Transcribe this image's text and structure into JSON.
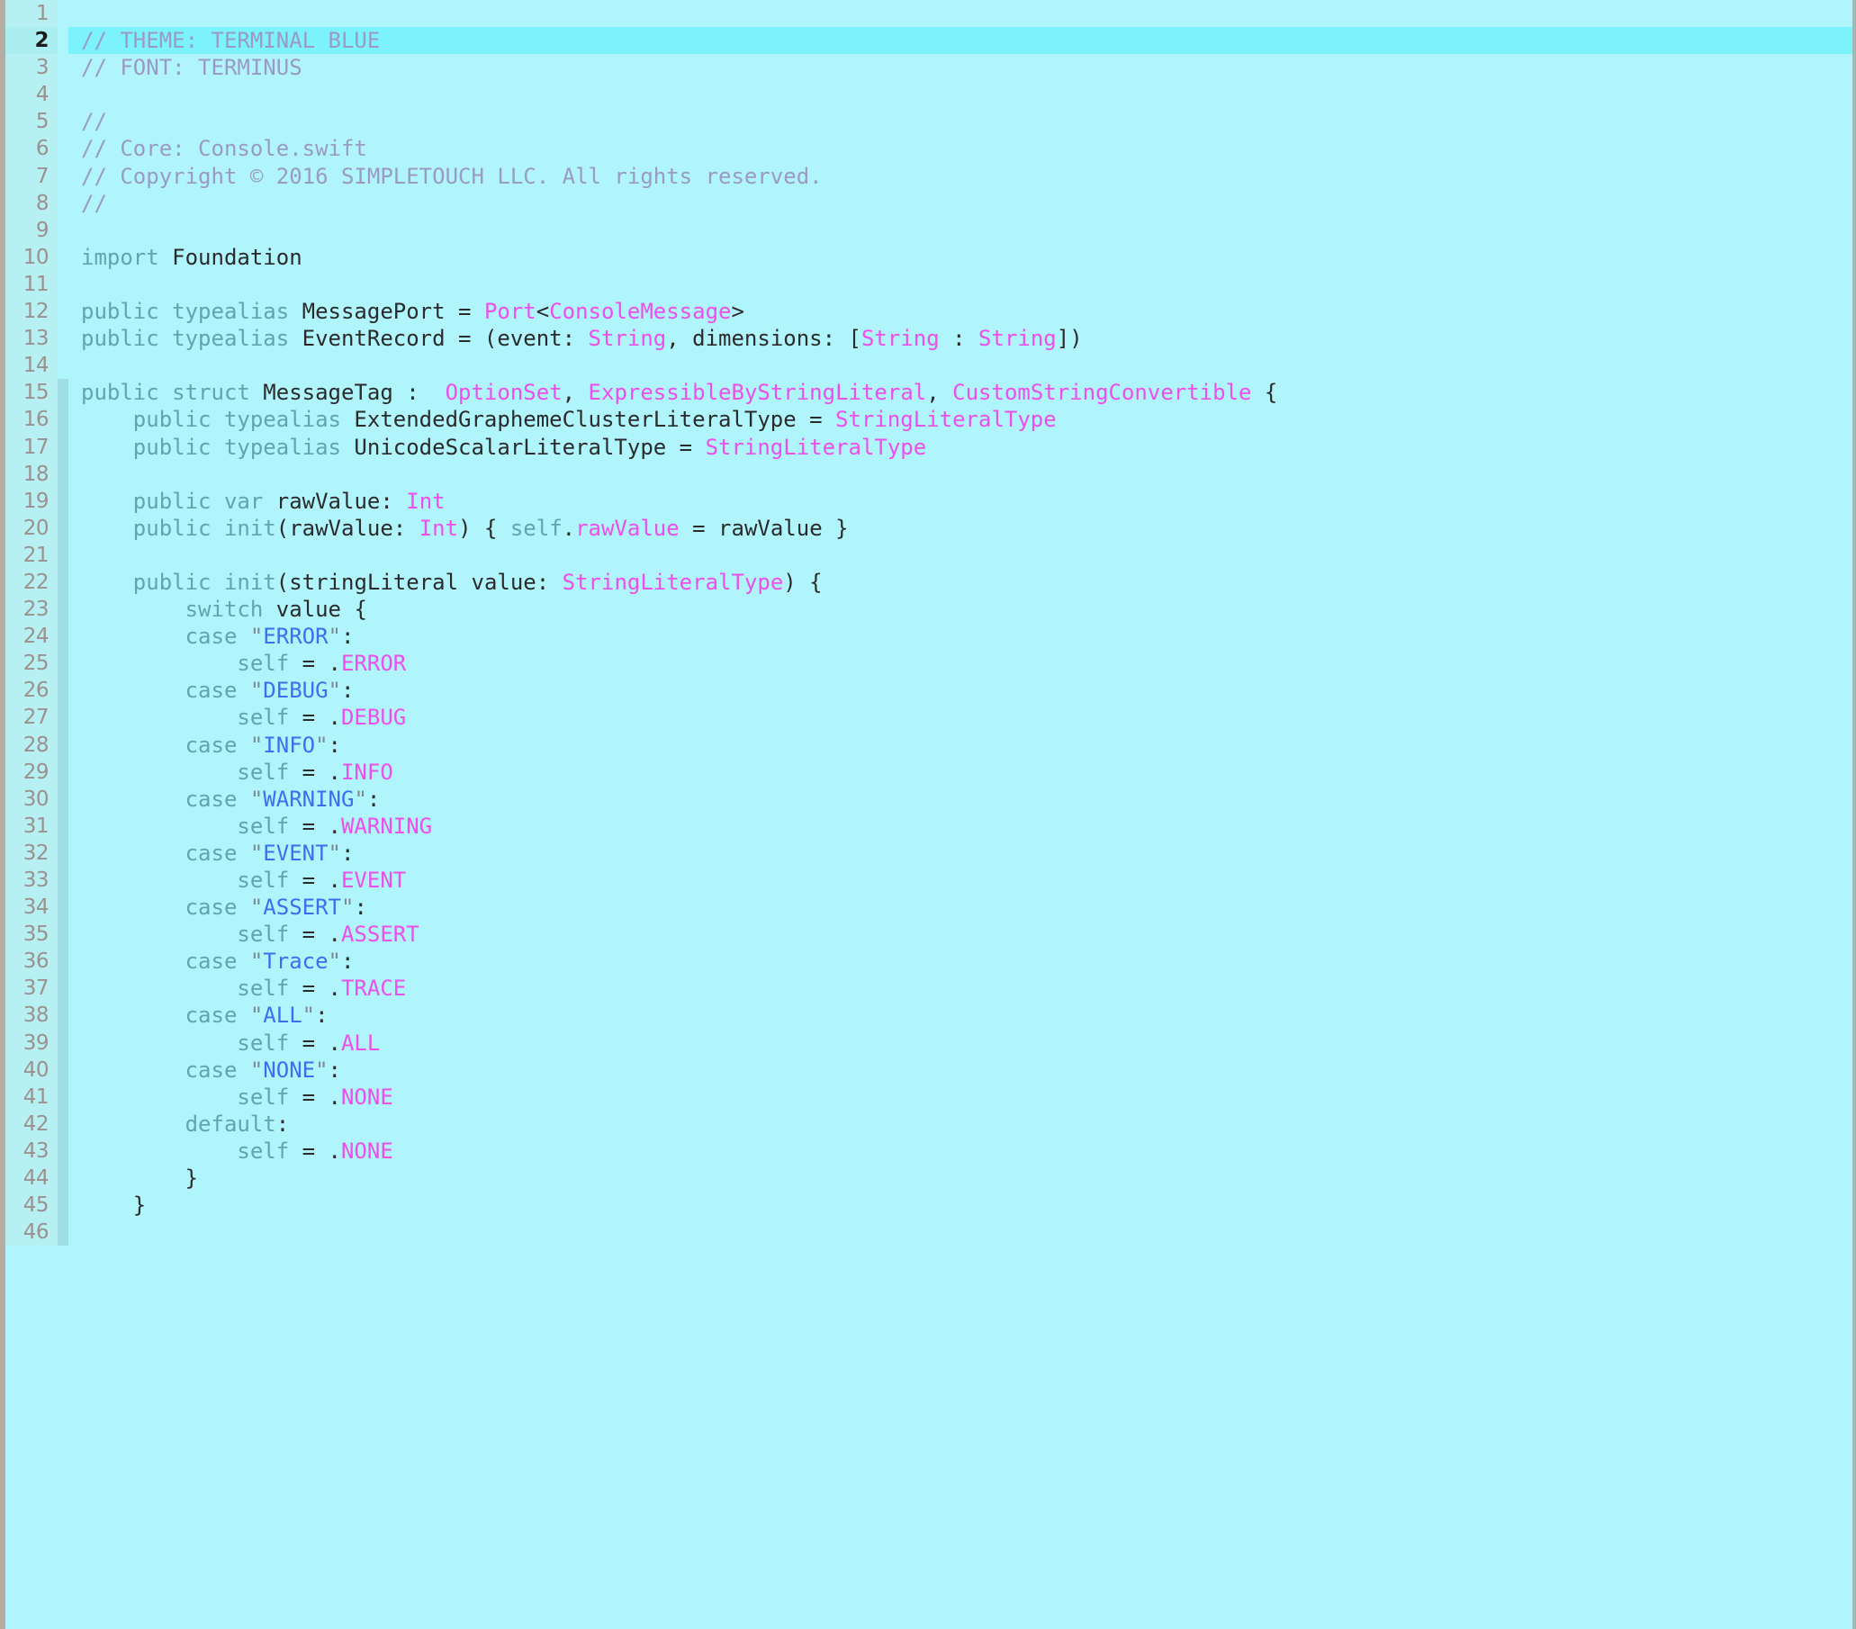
{
  "editor": {
    "language": "swift",
    "active_line": 2,
    "first_line": 1,
    "last_line": 46,
    "theme_name": "TERMINAL BLUE",
    "font_name": "TERMINUS",
    "colors": {
      "background": "#b0f5fc",
      "gutter_background": "#b6f0f3",
      "active_line_background": "#7cf2fb",
      "line_number": "#9b918e",
      "active_line_number": "#1c1c1c",
      "change_bar": "#9fdfe4",
      "comment": "#9a9ac4",
      "keyword": "#63a3b2",
      "identifier": "#2b2b2b",
      "type": "#ec4fec",
      "string": "#3c6ff0",
      "string_quote": "#7d8a95",
      "left_border": "#b5ada0",
      "right_border": "#9fb9b5"
    }
  },
  "lines": [
    {
      "n": "1",
      "mod": false,
      "tokens": []
    },
    {
      "n": "2",
      "mod": false,
      "active": true,
      "tokens": [
        {
          "c": "com",
          "t": "// THEME: TERMINAL BLUE"
        }
      ]
    },
    {
      "n": "3",
      "mod": false,
      "tokens": [
        {
          "c": "com",
          "t": "// FONT: TERMINUS"
        }
      ]
    },
    {
      "n": "4",
      "mod": false,
      "tokens": []
    },
    {
      "n": "5",
      "mod": false,
      "tokens": [
        {
          "c": "com",
          "t": "//"
        }
      ]
    },
    {
      "n": "6",
      "mod": false,
      "tokens": [
        {
          "c": "com",
          "t": "// Core: Console.swift"
        }
      ]
    },
    {
      "n": "7",
      "mod": false,
      "tokens": [
        {
          "c": "com",
          "t": "// Copyright © 2016 SIMPLETOUCH LLC. All rights reserved."
        }
      ]
    },
    {
      "n": "8",
      "mod": false,
      "tokens": [
        {
          "c": "com",
          "t": "//"
        }
      ]
    },
    {
      "n": "9",
      "mod": false,
      "tokens": []
    },
    {
      "n": "10",
      "mod": false,
      "tokens": [
        {
          "c": "kw",
          "t": "import"
        },
        {
          "c": "id",
          "t": " Foundation"
        }
      ]
    },
    {
      "n": "11",
      "mod": false,
      "tokens": []
    },
    {
      "n": "12",
      "mod": false,
      "tokens": [
        {
          "c": "kw",
          "t": "public typealias"
        },
        {
          "c": "id",
          "t": " MessagePort = "
        },
        {
          "c": "type",
          "t": "Port"
        },
        {
          "c": "pun",
          "t": "<"
        },
        {
          "c": "type",
          "t": "ConsoleMessage"
        },
        {
          "c": "pun",
          "t": ">"
        }
      ]
    },
    {
      "n": "13",
      "mod": false,
      "tokens": [
        {
          "c": "kw",
          "t": "public typealias"
        },
        {
          "c": "id",
          "t": " EventRecord = (event: "
        },
        {
          "c": "type",
          "t": "String"
        },
        {
          "c": "id",
          "t": ", dimensions: ["
        },
        {
          "c": "type",
          "t": "String"
        },
        {
          "c": "id",
          "t": " : "
        },
        {
          "c": "type",
          "t": "String"
        },
        {
          "c": "id",
          "t": "])"
        }
      ]
    },
    {
      "n": "14",
      "mod": false,
      "tokens": []
    },
    {
      "n": "15",
      "mod": true,
      "tokens": [
        {
          "c": "kw",
          "t": "public struct"
        },
        {
          "c": "id",
          "t": " MessageTag :  "
        },
        {
          "c": "type",
          "t": "OptionSet"
        },
        {
          "c": "id",
          "t": ", "
        },
        {
          "c": "type",
          "t": "ExpressibleByStringLiteral"
        },
        {
          "c": "id",
          "t": ", "
        },
        {
          "c": "type",
          "t": "CustomStringConvertible"
        },
        {
          "c": "id",
          "t": " {"
        }
      ]
    },
    {
      "n": "16",
      "mod": true,
      "tokens": [
        {
          "c": "id",
          "t": "    "
        },
        {
          "c": "kw",
          "t": "public typealias"
        },
        {
          "c": "id",
          "t": " ExtendedGraphemeClusterLiteralType = "
        },
        {
          "c": "type",
          "t": "StringLiteralType"
        }
      ]
    },
    {
      "n": "17",
      "mod": true,
      "tokens": [
        {
          "c": "id",
          "t": "    "
        },
        {
          "c": "kw",
          "t": "public typealias"
        },
        {
          "c": "id",
          "t": " UnicodeScalarLiteralType = "
        },
        {
          "c": "type",
          "t": "StringLiteralType"
        }
      ]
    },
    {
      "n": "18",
      "mod": true,
      "tokens": []
    },
    {
      "n": "19",
      "mod": true,
      "tokens": [
        {
          "c": "id",
          "t": "    "
        },
        {
          "c": "kw",
          "t": "public var"
        },
        {
          "c": "id",
          "t": " rawValue: "
        },
        {
          "c": "type",
          "t": "Int"
        }
      ]
    },
    {
      "n": "20",
      "mod": true,
      "tokens": [
        {
          "c": "id",
          "t": "    "
        },
        {
          "c": "kw",
          "t": "public init"
        },
        {
          "c": "id",
          "t": "(rawValue: "
        },
        {
          "c": "type",
          "t": "Int"
        },
        {
          "c": "id",
          "t": ") { "
        },
        {
          "c": "kw",
          "t": "self"
        },
        {
          "c": "id",
          "t": "."
        },
        {
          "c": "type",
          "t": "rawValue"
        },
        {
          "c": "id",
          "t": " = rawValue }"
        }
      ]
    },
    {
      "n": "21",
      "mod": true,
      "tokens": []
    },
    {
      "n": "22",
      "mod": true,
      "tokens": [
        {
          "c": "id",
          "t": "    "
        },
        {
          "c": "kw",
          "t": "public init"
        },
        {
          "c": "id",
          "t": "(stringLiteral value: "
        },
        {
          "c": "type",
          "t": "StringLiteralType"
        },
        {
          "c": "id",
          "t": ") {"
        }
      ]
    },
    {
      "n": "23",
      "mod": true,
      "tokens": [
        {
          "c": "id",
          "t": "        "
        },
        {
          "c": "kw",
          "t": "switch"
        },
        {
          "c": "id",
          "t": " value {"
        }
      ]
    },
    {
      "n": "24",
      "mod": true,
      "tokens": [
        {
          "c": "id",
          "t": "        "
        },
        {
          "c": "kw",
          "t": "case"
        },
        {
          "c": "id",
          "t": " "
        },
        {
          "c": "quo",
          "t": "\""
        },
        {
          "c": "str",
          "t": "ERROR"
        },
        {
          "c": "quo",
          "t": "\""
        },
        {
          "c": "id",
          "t": ":"
        }
      ]
    },
    {
      "n": "25",
      "mod": true,
      "tokens": [
        {
          "c": "id",
          "t": "            "
        },
        {
          "c": "kw",
          "t": "self"
        },
        {
          "c": "id",
          "t": " = ."
        },
        {
          "c": "type",
          "t": "ERROR"
        }
      ]
    },
    {
      "n": "26",
      "mod": true,
      "tokens": [
        {
          "c": "id",
          "t": "        "
        },
        {
          "c": "kw",
          "t": "case"
        },
        {
          "c": "id",
          "t": " "
        },
        {
          "c": "quo",
          "t": "\""
        },
        {
          "c": "str",
          "t": "DEBUG"
        },
        {
          "c": "quo",
          "t": "\""
        },
        {
          "c": "id",
          "t": ":"
        }
      ]
    },
    {
      "n": "27",
      "mod": true,
      "tokens": [
        {
          "c": "id",
          "t": "            "
        },
        {
          "c": "kw",
          "t": "self"
        },
        {
          "c": "id",
          "t": " = ."
        },
        {
          "c": "type",
          "t": "DEBUG"
        }
      ]
    },
    {
      "n": "28",
      "mod": true,
      "tokens": [
        {
          "c": "id",
          "t": "        "
        },
        {
          "c": "kw",
          "t": "case"
        },
        {
          "c": "id",
          "t": " "
        },
        {
          "c": "quo",
          "t": "\""
        },
        {
          "c": "str",
          "t": "INFO"
        },
        {
          "c": "quo",
          "t": "\""
        },
        {
          "c": "id",
          "t": ":"
        }
      ]
    },
    {
      "n": "29",
      "mod": true,
      "tokens": [
        {
          "c": "id",
          "t": "            "
        },
        {
          "c": "kw",
          "t": "self"
        },
        {
          "c": "id",
          "t": " = ."
        },
        {
          "c": "type",
          "t": "INFO"
        }
      ]
    },
    {
      "n": "30",
      "mod": true,
      "tokens": [
        {
          "c": "id",
          "t": "        "
        },
        {
          "c": "kw",
          "t": "case"
        },
        {
          "c": "id",
          "t": " "
        },
        {
          "c": "quo",
          "t": "\""
        },
        {
          "c": "str",
          "t": "WARNING"
        },
        {
          "c": "quo",
          "t": "\""
        },
        {
          "c": "id",
          "t": ":"
        }
      ]
    },
    {
      "n": "31",
      "mod": true,
      "tokens": [
        {
          "c": "id",
          "t": "            "
        },
        {
          "c": "kw",
          "t": "self"
        },
        {
          "c": "id",
          "t": " = ."
        },
        {
          "c": "type",
          "t": "WARNING"
        }
      ]
    },
    {
      "n": "32",
      "mod": true,
      "tokens": [
        {
          "c": "id",
          "t": "        "
        },
        {
          "c": "kw",
          "t": "case"
        },
        {
          "c": "id",
          "t": " "
        },
        {
          "c": "quo",
          "t": "\""
        },
        {
          "c": "str",
          "t": "EVENT"
        },
        {
          "c": "quo",
          "t": "\""
        },
        {
          "c": "id",
          "t": ":"
        }
      ]
    },
    {
      "n": "33",
      "mod": true,
      "tokens": [
        {
          "c": "id",
          "t": "            "
        },
        {
          "c": "kw",
          "t": "self"
        },
        {
          "c": "id",
          "t": " = ."
        },
        {
          "c": "type",
          "t": "EVENT"
        }
      ]
    },
    {
      "n": "34",
      "mod": true,
      "tokens": [
        {
          "c": "id",
          "t": "        "
        },
        {
          "c": "kw",
          "t": "case"
        },
        {
          "c": "id",
          "t": " "
        },
        {
          "c": "quo",
          "t": "\""
        },
        {
          "c": "str",
          "t": "ASSERT"
        },
        {
          "c": "quo",
          "t": "\""
        },
        {
          "c": "id",
          "t": ":"
        }
      ]
    },
    {
      "n": "35",
      "mod": true,
      "tokens": [
        {
          "c": "id",
          "t": "            "
        },
        {
          "c": "kw",
          "t": "self"
        },
        {
          "c": "id",
          "t": " = ."
        },
        {
          "c": "type",
          "t": "ASSERT"
        }
      ]
    },
    {
      "n": "36",
      "mod": true,
      "tokens": [
        {
          "c": "id",
          "t": "        "
        },
        {
          "c": "kw",
          "t": "case"
        },
        {
          "c": "id",
          "t": " "
        },
        {
          "c": "quo",
          "t": "\""
        },
        {
          "c": "str",
          "t": "Trace"
        },
        {
          "c": "quo",
          "t": "\""
        },
        {
          "c": "id",
          "t": ":"
        }
      ]
    },
    {
      "n": "37",
      "mod": true,
      "tokens": [
        {
          "c": "id",
          "t": "            "
        },
        {
          "c": "kw",
          "t": "self"
        },
        {
          "c": "id",
          "t": " = ."
        },
        {
          "c": "type",
          "t": "TRACE"
        }
      ]
    },
    {
      "n": "38",
      "mod": true,
      "tokens": [
        {
          "c": "id",
          "t": "        "
        },
        {
          "c": "kw",
          "t": "case"
        },
        {
          "c": "id",
          "t": " "
        },
        {
          "c": "quo",
          "t": "\""
        },
        {
          "c": "str",
          "t": "ALL"
        },
        {
          "c": "quo",
          "t": "\""
        },
        {
          "c": "id",
          "t": ":"
        }
      ]
    },
    {
      "n": "39",
      "mod": true,
      "tokens": [
        {
          "c": "id",
          "t": "            "
        },
        {
          "c": "kw",
          "t": "self"
        },
        {
          "c": "id",
          "t": " = ."
        },
        {
          "c": "type",
          "t": "ALL"
        }
      ]
    },
    {
      "n": "40",
      "mod": true,
      "tokens": [
        {
          "c": "id",
          "t": "        "
        },
        {
          "c": "kw",
          "t": "case"
        },
        {
          "c": "id",
          "t": " "
        },
        {
          "c": "quo",
          "t": "\""
        },
        {
          "c": "str",
          "t": "NONE"
        },
        {
          "c": "quo",
          "t": "\""
        },
        {
          "c": "id",
          "t": ":"
        }
      ]
    },
    {
      "n": "41",
      "mod": true,
      "tokens": [
        {
          "c": "id",
          "t": "            "
        },
        {
          "c": "kw",
          "t": "self"
        },
        {
          "c": "id",
          "t": " = ."
        },
        {
          "c": "type",
          "t": "NONE"
        }
      ]
    },
    {
      "n": "42",
      "mod": true,
      "tokens": [
        {
          "c": "id",
          "t": "        "
        },
        {
          "c": "kw",
          "t": "default"
        },
        {
          "c": "id",
          "t": ":"
        }
      ]
    },
    {
      "n": "43",
      "mod": true,
      "tokens": [
        {
          "c": "id",
          "t": "            "
        },
        {
          "c": "kw",
          "t": "self"
        },
        {
          "c": "id",
          "t": " = ."
        },
        {
          "c": "type",
          "t": "NONE"
        }
      ]
    },
    {
      "n": "44",
      "mod": true,
      "tokens": [
        {
          "c": "id",
          "t": "        }"
        }
      ]
    },
    {
      "n": "45",
      "mod": true,
      "tokens": [
        {
          "c": "id",
          "t": "    }"
        }
      ]
    },
    {
      "n": "46",
      "mod": true,
      "tokens": []
    }
  ]
}
